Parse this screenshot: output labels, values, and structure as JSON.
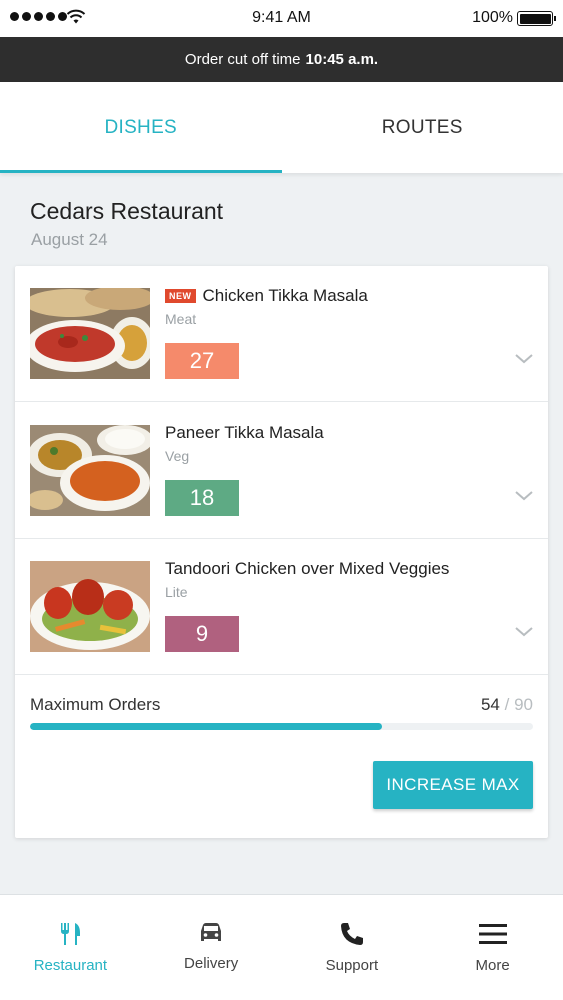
{
  "status_bar": {
    "time": "9:41 AM",
    "battery": "100%"
  },
  "cutoff": {
    "prefix": "Order cut off time",
    "time": "10:45 a.m."
  },
  "tabs": [
    {
      "label": "DISHES",
      "active": true
    },
    {
      "label": "ROUTES",
      "active": false
    }
  ],
  "restaurant": {
    "name": "Cedars Restaurant",
    "date": "August 24"
  },
  "dishes": [
    {
      "name": "Chicken Tikka Masala",
      "badge": "NEW",
      "category": "Meat",
      "count": "27",
      "count_color": "#f58a6b"
    },
    {
      "name": "Paneer Tikka Masala",
      "category": "Veg",
      "count": "18",
      "count_color": "#5eaa84"
    },
    {
      "name": "Tandoori Chicken over Mixed Veggies",
      "category": "Lite",
      "count": "9",
      "count_color": "#b0617f"
    }
  ],
  "max_orders": {
    "label": "Maximum Orders",
    "current": "54",
    "separator": "/",
    "total": "90",
    "progress": 0.7,
    "bar_color": "#26b3c3"
  },
  "increase_button": {
    "label": "INCREASE MAX",
    "color": "#26b3c3"
  },
  "bottom_nav": [
    {
      "label": "Restaurant",
      "icon": "fork-knife-icon",
      "active": true
    },
    {
      "label": "Delivery",
      "icon": "car-icon",
      "active": false
    },
    {
      "label": "Support",
      "icon": "phone-icon",
      "active": false
    },
    {
      "label": "More",
      "icon": "menu-icon",
      "active": false
    }
  ],
  "colors": {
    "accent": "#26b3c3",
    "header_dark": "#2e2e2e",
    "background": "#eef1f3"
  }
}
